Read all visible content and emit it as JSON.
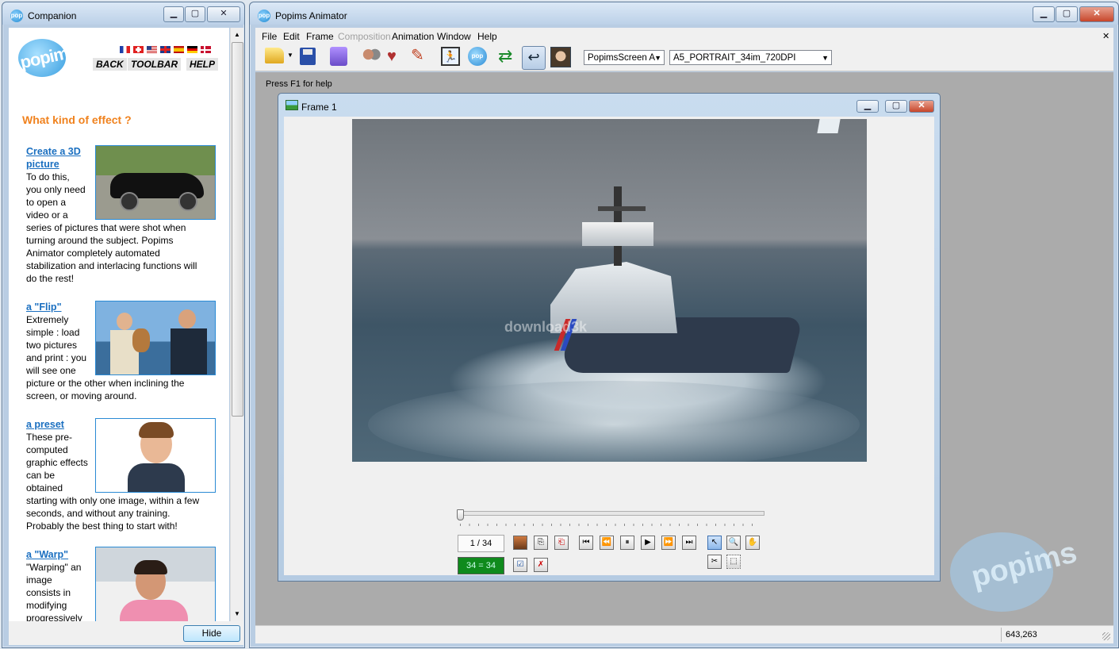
{
  "companion": {
    "title": "Companion",
    "logo_text": "popims",
    "nav": {
      "back": "BACK",
      "toolbar": "TOOLBAR",
      "help": "HELP"
    },
    "heading": "What kind of effect ?",
    "items": [
      {
        "title_line1": "Create a 3D",
        "title_line2": "picture",
        "side_lines": [
          "To do this,",
          "you only need",
          "to open a",
          "video or a"
        ],
        "full_lines": [
          "series of pictures that were shot when",
          "turning around the subject. Popims",
          "Animator completely automated",
          "stabilization and interlacing functions will",
          "do the rest!"
        ]
      },
      {
        "title_line1": "a \"Flip\"",
        "side_lines": [
          "Extremely",
          "simple : load",
          "two pictures",
          "and print : you",
          "will see one"
        ],
        "full_lines": [
          "picture or the other when inclining the",
          "screen, or moving around."
        ]
      },
      {
        "title_line1": "a preset",
        "side_lines": [
          "These pre-",
          "computed",
          "graphic effects",
          "can be",
          "obtained"
        ],
        "full_lines": [
          "starting with only one image, within a few",
          "seconds, and without any training.",
          "Probably the best thing to start with!"
        ]
      },
      {
        "title_line1": "a \"Warp\"",
        "side_lines": [
          "\"Warping\" an",
          "image",
          "consists in",
          "modifying",
          "progressively"
        ],
        "full_lines": []
      }
    ],
    "hide_label": "Hide"
  },
  "main": {
    "title": "Popims Animator",
    "menu": [
      "File",
      "Edit",
      "Frame",
      "Composition",
      "Animation",
      "Window",
      "Help"
    ],
    "combo_screen": "PopimsScreen A",
    "combo_format": "A5_PORTRAIT_34im_720DPI",
    "status_hint": "Press F1 for help",
    "status_coords": "643,263"
  },
  "frame": {
    "title": "Frame 1",
    "watermark": "download3k",
    "counter": "1 / 34",
    "range": "34 = 34"
  },
  "colors": {
    "accent_orange": "#f0821e",
    "link_blue": "#1a6fc0",
    "range_green": "#0f8a1c"
  }
}
